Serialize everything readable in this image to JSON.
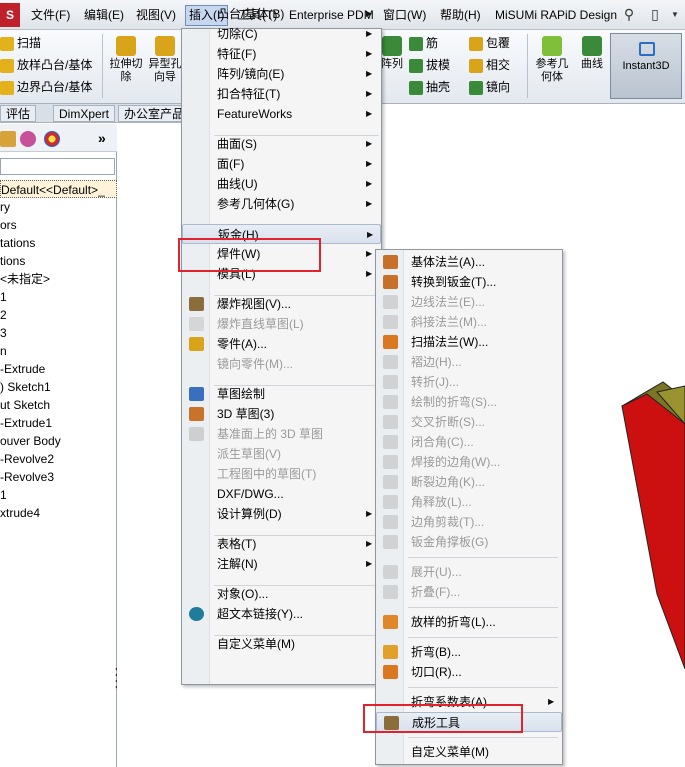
{
  "menubar": {
    "logo": "S",
    "items": [
      "文件(F)",
      "编辑(E)",
      "视图(V)",
      "插入(I)",
      "工具(T)",
      "Enterprise PDM",
      "窗口(W)",
      "帮助(H)",
      "MiSUMi RAPiD Design"
    ]
  },
  "cmdbar": {
    "left_small": [
      "扫描",
      "放样凸台/基体",
      "边界凸台/基体"
    ],
    "big": [
      "拉伸切\n除",
      "异型孔\n向导"
    ],
    "right_small": [
      "筋",
      "拔模",
      "抽壳",
      "包覆",
      "相交",
      "镜向"
    ],
    "partial": "阵列",
    "ref_geom": "参考几\n何体",
    "curves": "曲线",
    "instant3d": "Instant3D"
  },
  "tabs": [
    "评估",
    "DimXpert",
    "办公室产品"
  ],
  "feature_tree": [
    "Default<<Default>_",
    "ry",
    "ors",
    "tations",
    "tions",
    "<未指定>",
    "1",
    "2",
    "3",
    "n",
    "-Extrude",
    ") Sketch1",
    "ut Sketch",
    "-Extrude1",
    "ouver Body",
    "-Revolve2",
    "-Revolve3",
    "1",
    "xtrude4"
  ],
  "insert_menu": [
    {
      "label": "凸台/基体(B)",
      "arrow": true
    },
    {
      "label": "切除(C)",
      "arrow": true
    },
    {
      "label": "特征(F)",
      "arrow": true
    },
    {
      "label": "阵列/镜向(E)",
      "arrow": true
    },
    {
      "label": "扣合特征(T)",
      "arrow": true
    },
    {
      "label": "FeatureWorks",
      "arrow": true
    },
    {
      "label": "曲面(S)",
      "arrow": true
    },
    {
      "label": "面(F)",
      "arrow": true
    },
    {
      "label": "曲线(U)",
      "arrow": true
    },
    {
      "label": "参考几何体(G)",
      "arrow": true
    },
    {
      "label": "钣金(H)",
      "arrow": true
    },
    {
      "label": "焊件(W)",
      "arrow": true
    },
    {
      "label": "模具(L)",
      "arrow": true
    },
    {
      "label": "爆炸视图(V)...",
      "icon": "explode-view-icon"
    },
    {
      "label": "爆炸直线草图(L)",
      "icon": "explode-line-sketch-icon"
    },
    {
      "label": "零件(A)...",
      "icon": "insert-part-icon"
    },
    {
      "label": "镜向零件(M)..."
    },
    {
      "label": "草图绘制",
      "icon": "sketch-icon"
    },
    {
      "label": "3D 草图(3)",
      "icon": "3d-sketch-icon"
    },
    {
      "label": "基准面上的 3D 草图",
      "icon": "3d-sketch-on-plane-icon"
    },
    {
      "label": "派生草图(V)"
    },
    {
      "label": "工程图中的草图(T)"
    },
    {
      "label": "DXF/DWG..."
    },
    {
      "label": "设计算例(D)",
      "arrow": true
    },
    {
      "label": "表格(T)",
      "arrow": true
    },
    {
      "label": "注解(N)",
      "arrow": true
    },
    {
      "label": "对象(O)..."
    },
    {
      "label": "超文本链接(Y)...",
      "icon": "hyperlink-globe-icon"
    },
    {
      "label": "自定义菜单(M)"
    }
  ],
  "sheetmetal_menu": [
    {
      "label": "基体法兰(A)..."
    },
    {
      "label": "转换到钣金(T)..."
    },
    {
      "label": "边线法兰(E)..."
    },
    {
      "label": "斜接法兰(M)..."
    },
    {
      "label": "扫描法兰(W)..."
    },
    {
      "label": "褶边(H)..."
    },
    {
      "label": "转折(J)..."
    },
    {
      "label": "绘制的折弯(S)..."
    },
    {
      "label": "交叉折断(S)..."
    },
    {
      "label": "闭合角(C)..."
    },
    {
      "label": "焊接的边角(W)..."
    },
    {
      "label": "断裂边角(K)..."
    },
    {
      "label": "角释放(L)..."
    },
    {
      "label": "边角剪裁(T)..."
    },
    {
      "label": "钣金角撑板(G)"
    },
    {
      "label": "展开(U)..."
    },
    {
      "label": "折叠(F)..."
    },
    {
      "label": "放样的折弯(L)..."
    },
    {
      "label": "折弯(B)..."
    },
    {
      "label": "切口(R)..."
    },
    {
      "label": "折弯系数表(A)"
    },
    {
      "label": "成形工具"
    },
    {
      "label": "自定义菜单(M)"
    }
  ],
  "colors": {
    "highlight_box": "#e0232c",
    "part_red": "#cc1010",
    "part_olive": "#8f8a2e"
  }
}
